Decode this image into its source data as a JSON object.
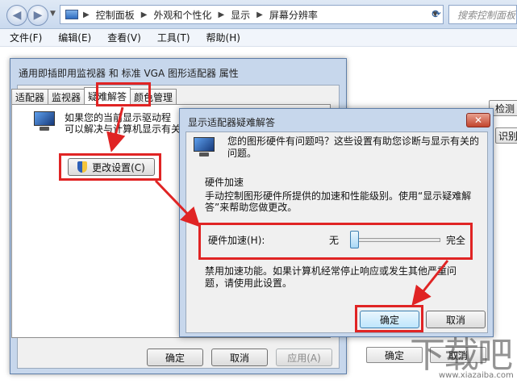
{
  "explorer": {
    "breadcrumb": [
      "控制面板",
      "外观和个性化",
      "显示",
      "屏幕分辨率"
    ],
    "search_placeholder": "搜索控制面板",
    "menu": [
      "文件(F)",
      "编辑(E)",
      "查看(V)",
      "工具(T)",
      "帮助(H)"
    ],
    "right_buttons": [
      "检测",
      "识别"
    ],
    "bottom_buttons": [
      "确定",
      "取消"
    ]
  },
  "properties_dialog": {
    "title": "通用即插即用监视器 和 标准 VGA 图形适配器 属性",
    "tabs": [
      "适配器",
      "监视器",
      "疑难解答",
      "颜色管理"
    ],
    "active_tab": "疑难解答",
    "desc_line1": "如果您的当前显示驱动程",
    "desc_line2": "可以解决与计算机显示有关",
    "change_settings": "更改设置(C)",
    "ok": "确定",
    "cancel": "取消",
    "apply": "应用(A)"
  },
  "troubleshoot_dialog": {
    "title": "显示适配器疑难解答",
    "close": "✕",
    "intro_line1": "您的图形硬件有问题吗？这些设置有助您诊断与显示有关的",
    "intro_line2": "问题。",
    "section_title": "硬件加速",
    "section_desc_line1": "手动控制图形硬件所提供的加速和性能级别。使用“显示疑难解",
    "section_desc_line2": "答”来帮助您做更改。",
    "slider_label": "硬件加速(H):",
    "slider_min": "无",
    "slider_max": "完全",
    "slider_fraction": 0.0,
    "note_line1": "禁用加速功能。如果计算机经常停止响应或发生其他严重问",
    "note_line2": "题，请使用此设置。",
    "ok": "确定",
    "cancel": "取消"
  },
  "colors": {
    "annotation_red": "#e02424",
    "title_bar": "#c7d7ec"
  },
  "watermark": {
    "logo_text": "下载吧",
    "url": "www.xiazaiba.com"
  }
}
